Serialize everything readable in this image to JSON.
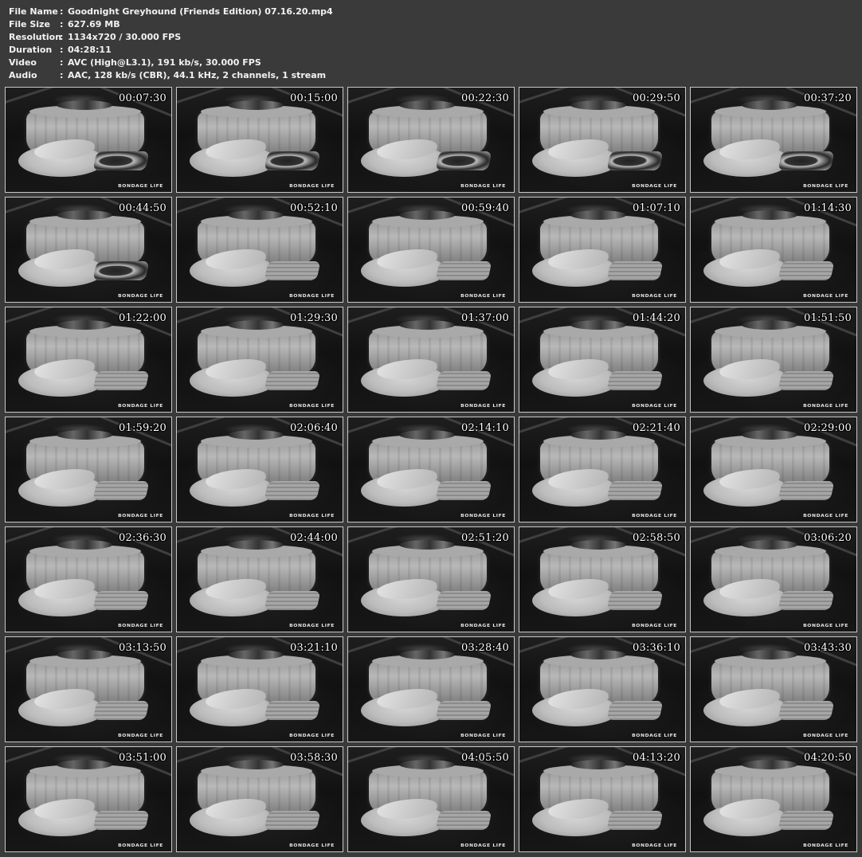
{
  "info": [
    {
      "label": "File Name",
      "sep": ":",
      "value": "Goodnight Greyhound (Friends Edition) 07.16.20.mp4"
    },
    {
      "label": "File Size",
      "sep": ":",
      "value": "627.69 MB"
    },
    {
      "label": "Resolution",
      "sep": ":",
      "value": "1134x720 / 30.000 FPS"
    },
    {
      "label": "Duration",
      "sep": ":",
      "value": "04:28:11"
    },
    {
      "label": "Video",
      "sep": ":",
      "value": "AVC (High@L3.1), 191 kb/s, 30.000 FPS"
    },
    {
      "label": "Audio",
      "sep": ":",
      "value": "AAC, 128 kb/s (CBR), 44.1 kHz, 2 channels, 1 stream"
    }
  ],
  "watermark": "BONDAGE LIFE",
  "thumbnails": [
    "00:07:30",
    "00:15:00",
    "00:22:30",
    "00:29:50",
    "00:37:20",
    "00:44:50",
    "00:52:10",
    "00:59:40",
    "01:07:10",
    "01:14:30",
    "01:22:00",
    "01:29:30",
    "01:37:00",
    "01:44:20",
    "01:51:50",
    "01:59:20",
    "02:06:40",
    "02:14:10",
    "02:21:40",
    "02:29:00",
    "02:36:30",
    "02:44:00",
    "02:51:20",
    "02:58:50",
    "03:06:20",
    "03:13:50",
    "03:21:10",
    "03:28:40",
    "03:36:10",
    "03:43:30",
    "03:51:00",
    "03:58:30",
    "04:05:50",
    "04:13:20",
    "04:20:50"
  ]
}
